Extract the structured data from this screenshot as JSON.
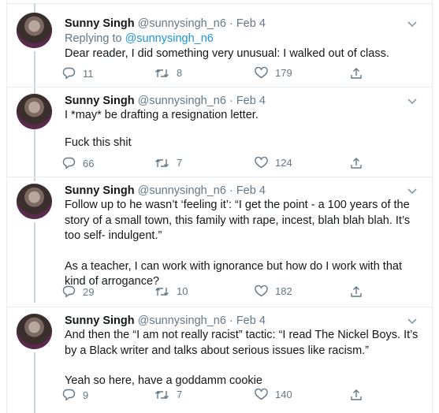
{
  "tweets": [
    {
      "name": "Sunny Singh",
      "handle": "@sunnysingh_n6",
      "date": "Feb 4",
      "replying_to_label": "Replying to",
      "replying_to": "@sunnysingh_n6",
      "paragraphs": [
        "Dear reader, I did something very unusual: I walked out of class."
      ],
      "replies": "11",
      "retweets": "8",
      "likes": "179"
    },
    {
      "name": "Sunny Singh",
      "handle": "@sunnysingh_n6",
      "date": "Feb 4",
      "paragraphs": [
        "I *may* be drafting a resignation letter.",
        "Fuck this shit"
      ],
      "replies": "66",
      "retweets": "7",
      "likes": "124"
    },
    {
      "name": "Sunny Singh",
      "handle": "@sunnysingh_n6",
      "date": "Feb 4",
      "paragraphs": [
        "Follow up to he wasn’t ‘feeling it’: “I get the point - a 100 years of the story of a small town, this family with rape, incest, blah blah blah. It’s too self- indulgent.”",
        "As a teacher, I can work with ignorance but how do I work with that kind of arrogance?"
      ],
      "replies": "29",
      "retweets": "10",
      "likes": "182"
    },
    {
      "name": "Sunny Singh",
      "handle": "@sunnysingh_n6",
      "date": "Feb 4",
      "paragraphs": [
        "And then the “I am not really racist” tactic: “I read The Nickel Boys. It’s by a Black writer and talks about serious issues like racism.”",
        "Yeah so here, have a goddamm cookie"
      ],
      "replies": "9",
      "retweets": "7",
      "likes": "140"
    }
  ],
  "header_separator": " · ",
  "icons": {
    "menu": "chevron-down-icon",
    "reply": "reply-icon",
    "retweet": "retweet-icon",
    "like": "heart-icon",
    "share": "share-icon"
  },
  "colors": {
    "text": "#14171a",
    "secondary": "#657786",
    "link": "#1b95e0",
    "border": "#e6ecf0"
  }
}
